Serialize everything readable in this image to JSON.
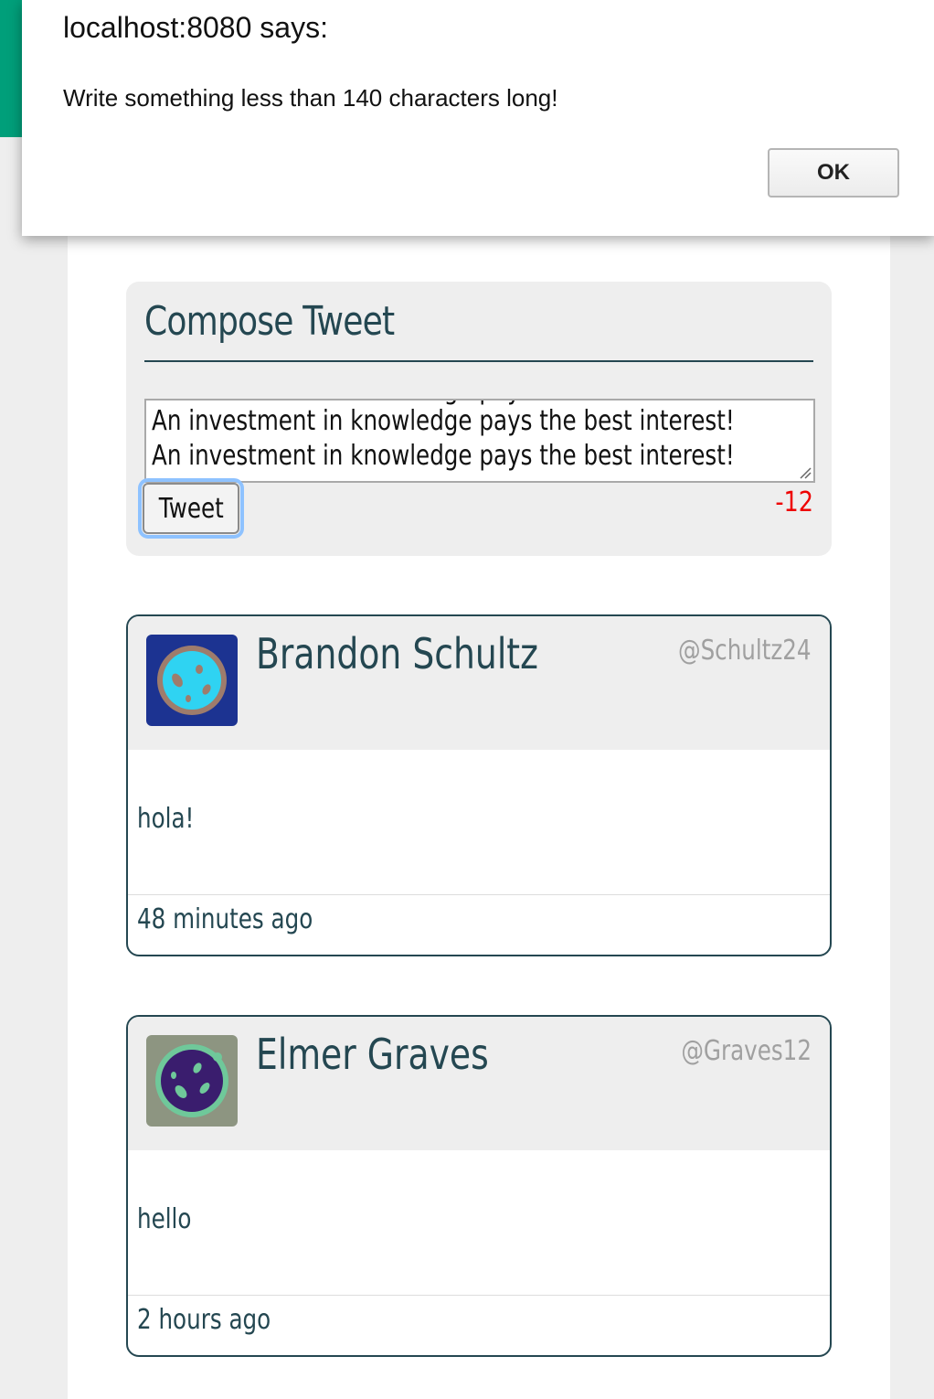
{
  "dialog": {
    "title": "localhost:8080 says:",
    "message": "Write something less than 140 characters long!",
    "ok_label": "OK"
  },
  "compose": {
    "title": "Compose Tweet",
    "textarea_cut_line": "An investment in knowledge pays the best interest!",
    "textarea_lines": [
      "An investment in knowledge pays the best interest!",
      "An investment in knowledge pays the best interest!"
    ],
    "button_label": "Tweet",
    "counter": "-12",
    "counter_color": "#ee0000"
  },
  "tweets": [
    {
      "name": "Brandon Schultz",
      "handle": "@Schultz24",
      "body": "hola!",
      "time": "48 minutes ago",
      "avatar_icon": "planet-avatar-icon",
      "avatar_bg": "#1c3391",
      "avatar_fill": "#2fd3f2",
      "avatar_ring": "#9e7c6c"
    },
    {
      "name": "Elmer Graves",
      "handle": "@Graves12",
      "body": "hello",
      "time": "2 hours ago",
      "avatar_icon": "planet-avatar-icon",
      "avatar_bg": "#8d9581",
      "avatar_fill": "#3a1d6e",
      "avatar_ring": "#6fc89a"
    }
  ],
  "colors": {
    "header_bar": "#009f7a",
    "accent": "#244751",
    "page_bg": "#eeeeee"
  }
}
